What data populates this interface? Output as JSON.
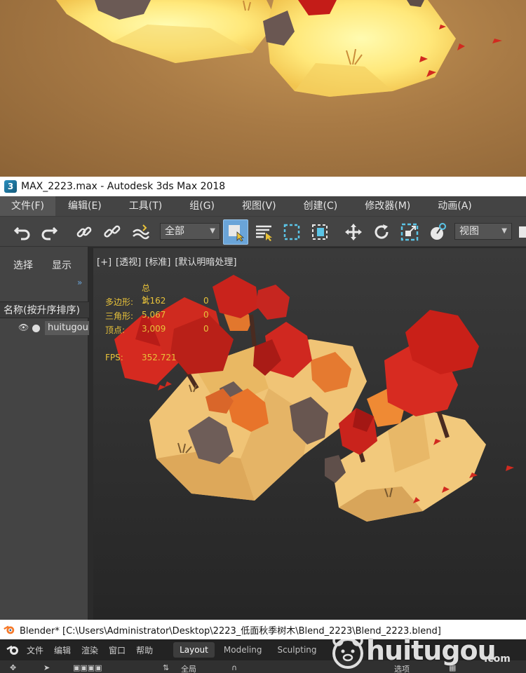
{
  "max": {
    "title": "MAX_2223.max - Autodesk 3ds Max 2018",
    "menu": [
      "文件(F)",
      "编辑(E)",
      "工具(T)",
      "组(G)",
      "视图(V)",
      "创建(C)",
      "修改器(M)",
      "动画(A)"
    ],
    "toolbar": {
      "selection_filter": "全部",
      "reference_coord": "视图"
    },
    "left_panel": {
      "tabs": [
        "选择",
        "显示"
      ],
      "column_header": "名称(按升序排序)",
      "object_name": "huitugou"
    },
    "viewport": {
      "labels": [
        "[+]",
        "[透视]",
        "[标准]",
        "[默认明暗处理]"
      ],
      "stats": {
        "total_header": "总计",
        "rows": [
          {
            "label": "多边形:",
            "total": "3,162",
            "selected": "0"
          },
          {
            "label": "三角形:",
            "total": "5,067",
            "selected": "0"
          },
          {
            "label": "顶点:",
            "total": "3,009",
            "selected": "0"
          }
        ],
        "fps_label": "FPS:",
        "fps_value": "352.721"
      }
    }
  },
  "blender": {
    "title": "Blender* [C:\\Users\\Administrator\\Desktop\\2223_低面秋季树木\\Blend_2223\\Blend_2223.blend]",
    "menu": [
      "文件",
      "编辑",
      "渲染",
      "窗口",
      "帮助"
    ],
    "workspaces": [
      "Layout",
      "Modeling",
      "Sculpting"
    ],
    "toolbar": {
      "global": "全局",
      "options": "选项"
    }
  },
  "watermark": {
    "text": "huitugou",
    "suffix": ".com"
  },
  "colors": {
    "max_panel": "#444444",
    "selected_tool": "#6aa4d8",
    "stats_text": "#e8c23a",
    "ground": "#e8b764",
    "leaf_red": "#c8281e"
  }
}
